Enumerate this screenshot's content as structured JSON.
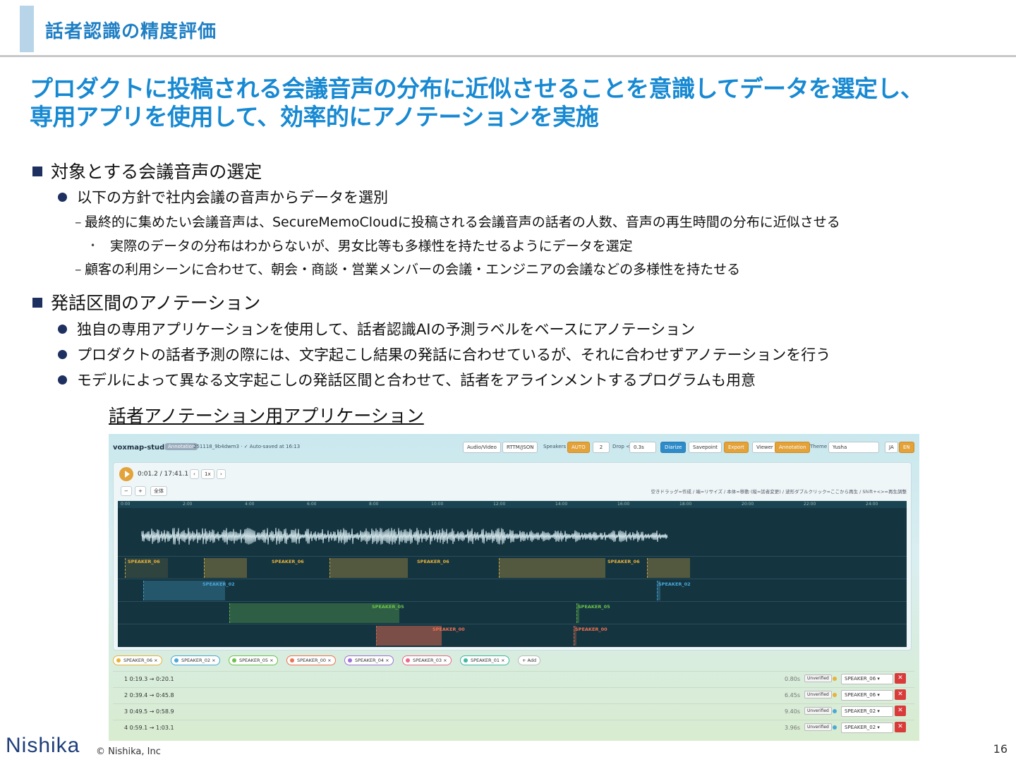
{
  "header": {
    "title": "話者認識の精度評価"
  },
  "lead": {
    "line1": "プロダクトに投稿される会議音声の分布に近似させることを意識してデータを選定し、",
    "line2": "専用アプリを使用して、効率的にアノテーションを実施"
  },
  "section1": {
    "title": "対象とする会議音声の選定",
    "bullet1": "以下の方針で社内会議の音声からデータを選別",
    "dash1": "最終的に集めたい会議音声は、SecureMemoCloudに投稿される会議音声の話者の人数、音声の再生時間の分布に近似させる",
    "sub1": "実際のデータの分布はわからないが、男女比等も多様性を持たせるようにデータを選定",
    "dash2": "顧客の利用シーンに合わせて、朝会・商談・営業メンバーの会議・エンジニアの会議などの多様性を持たせる"
  },
  "section2": {
    "title": "発話区間のアノテーション",
    "bullet1": "独自の専用アプリケーションを使用して、話者認識AIの予測ラベルをベースにアノテーション",
    "bullet2": "プロダクトの話者予測の際には、文字起こし結果の発話に合わせているが、それに合わせずアノテーションを行う",
    "bullet3": "モデルによって異なる文字起こしの発話区間と合わせて、話者をアラインメントするプログラムも用意"
  },
  "caption": "話者アノテーション用アプリケーション",
  "app": {
    "brand": "voxmap-studio",
    "mode_tag": "Annotation",
    "file": "251118_9b4dwm3 · ✓ Auto-saved at 16:13",
    "audio_btn": "Audio/Video",
    "rttm_btn": "RTTM/JSON",
    "speakers_label": "Speakers",
    "auto_btn": "AUTO",
    "speakers_value": "2",
    "drop_label": "Drop <",
    "drop_value": "0.3s",
    "diarize_btn": "Diarize",
    "savepoint_btn": "Savepoint",
    "export_btn": "Export",
    "viewer_btn": "Viewer",
    "annotation_btn": "Annotation",
    "theme_label": "Theme",
    "theme_value": "Yusha",
    "ja_btn": "JA",
    "en_btn": "EN",
    "time": "0:01.2 / 17:41.1",
    "speed": "1x",
    "zoom_out": "−",
    "zoom_in": "+",
    "full_btn": "全体",
    "hint": "空きドラッグ=作成 / 端=リサイズ / 本体=移動 (縦=話者変更) / 波形ダブルクリック=ここから再生 / Shift+<>=再生調整",
    "ruler": [
      "0:00",
      "2:00",
      "4:00",
      "6:00",
      "8:00",
      "10:00",
      "12:00",
      "14:00",
      "16:00",
      "18:00",
      "20:00",
      "22:00",
      "24:00"
    ],
    "lane_labels": {
      "l1a": "SPEAKER_06",
      "l1b": "SPEAKER_06",
      "l1c": "SPEAKER_06",
      "l1d": "SPEAKER_06",
      "l2a": "SPEAKER_02",
      "l2b": "SPEAKER_02",
      "l3a": "SPEAKER_05",
      "l3b": "SPEAKER_05",
      "l4a": "SPEAKER_00",
      "l4b": "SPEAKER_00"
    },
    "chips": [
      "SPEAKER_06",
      "SPEAKER_02",
      "SPEAKER_05",
      "SPEAKER_00",
      "SPEAKER_04",
      "SPEAKER_03",
      "SPEAKER_01"
    ],
    "add_chip": "+ Add",
    "chip_colors": [
      "#e8b23a",
      "#4aa8d8",
      "#6cc24a",
      "#f07050",
      "#a070d8",
      "#e86a8a",
      "#40b8a0"
    ],
    "rows": [
      {
        "range": "1  0:19.3 → 0:20.1",
        "dur": "0.80s",
        "state": "Unverified",
        "speaker": "SPEAKER_06",
        "color": "#e8b23a"
      },
      {
        "range": "2  0:39.4 → 0:45.8",
        "dur": "6.45s",
        "state": "Unverified",
        "speaker": "SPEAKER_06",
        "color": "#e8b23a"
      },
      {
        "range": "3  0:49.5 → 0:58.9",
        "dur": "9.40s",
        "state": "Unverified",
        "speaker": "SPEAKER_02",
        "color": "#4aa8d8"
      },
      {
        "range": "4  0:59.1 → 1:03.1",
        "dur": "3.96s",
        "state": "Unverified",
        "speaker": "SPEAKER_02",
        "color": "#4aa8d8"
      }
    ]
  },
  "footer": {
    "logo": "Nishika",
    "copyright": "© Nishika, Inc",
    "page": "16"
  }
}
